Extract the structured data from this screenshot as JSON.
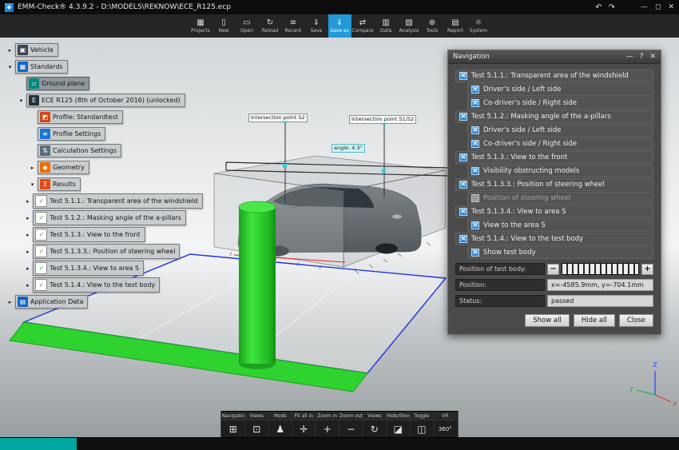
{
  "window": {
    "title": "EMM-Check® 4.3.9.2 - D:\\MODELS\\REKNOW\\ECE_R125.ecp",
    "icons": {
      "app": "◆",
      "undo": "↶",
      "redo": "↷",
      "minimize": "—",
      "maximize": "◻",
      "close": "✕"
    }
  },
  "toolbar": {
    "items": [
      {
        "label": "Projects",
        "icon": "▦"
      },
      {
        "label": "New",
        "icon": "▯"
      },
      {
        "label": "Open",
        "icon": "▭"
      },
      {
        "label": "Reload",
        "icon": "↻"
      },
      {
        "label": "Recent",
        "icon": "≡"
      },
      {
        "label": "Save",
        "icon": "⇓"
      },
      {
        "label": "Save as",
        "icon": "⇓",
        "active": true
      },
      {
        "label": "Compare",
        "icon": "⇄"
      },
      {
        "label": "Data",
        "icon": "▥"
      },
      {
        "label": "Analysis",
        "icon": "▧"
      },
      {
        "label": "Tools",
        "icon": "⊕"
      },
      {
        "label": "Report",
        "icon": "▤"
      },
      {
        "label": "System",
        "icon": "☼"
      }
    ]
  },
  "tree": {
    "items": [
      {
        "label": "Vehicle",
        "level": 0,
        "arrow": "▸",
        "glyph": "▣",
        "color": "#37474f"
      },
      {
        "label": "Standards",
        "level": 0,
        "arrow": "▾",
        "glyph": "▦",
        "color": "#1565c0"
      },
      {
        "label": "Ground plane",
        "level": 1,
        "arrow": "",
        "glyph": "▱",
        "color": "#00897b",
        "selected": true
      },
      {
        "label": "ECE R125 (8th of October 2016) (unlocked)",
        "level": 1,
        "arrow": "▾",
        "glyph": "E",
        "color": "#263238"
      },
      {
        "label": "Profile: Standardtest",
        "level": 2,
        "arrow": "",
        "glyph": "◩",
        "color": "#d84315"
      },
      {
        "label": "Profile Settings",
        "level": 2,
        "arrow": "",
        "glyph": "≡",
        "color": "#1976d2"
      },
      {
        "label": "Calculation Settings",
        "level": 2,
        "arrow": "",
        "glyph": "⇅",
        "color": "#546e7a"
      },
      {
        "label": "Geometry",
        "level": 2,
        "arrow": "▸",
        "glyph": "◆",
        "color": "#ef6c00"
      },
      {
        "label": "Results",
        "level": 2,
        "arrow": "▾",
        "glyph": "Σ",
        "color": "#e64a19"
      },
      {
        "label": "Test 5.1.1.: Transparent area of the windshield",
        "level": 1.6,
        "arrow": "▸",
        "glyph": "✓",
        "color": "#ffffff",
        "fg": "#1db11d"
      },
      {
        "label": "Test 5.1.2.: Masking angle of the a-pillars",
        "level": 1.6,
        "arrow": "▸",
        "glyph": "✓",
        "color": "#ffffff",
        "fg": "#1db11d"
      },
      {
        "label": "Test 5.1.3.: View to the front",
        "level": 1.6,
        "arrow": "▸",
        "glyph": "✓",
        "color": "#ffffff",
        "fg": "#1db11d"
      },
      {
        "label": "Test 5.1.3.3.: Position of steering wheel",
        "level": 1.6,
        "arrow": "▸",
        "glyph": "✓",
        "color": "#ffffff",
        "fg": "#1db11d"
      },
      {
        "label": "Test 5.1.3.4.: View to area S",
        "level": 1.6,
        "arrow": "▸",
        "glyph": "✓",
        "color": "#ffffff",
        "fg": "#1db11d"
      },
      {
        "label": "Test 5.1.4.: View to the test body",
        "level": 1.6,
        "arrow": "▸",
        "glyph": "✓",
        "color": "#ffffff",
        "fg": "#1db11d"
      },
      {
        "label": "Application Data",
        "level": 0,
        "arrow": "▸",
        "glyph": "▤",
        "color": "#1565c0"
      }
    ]
  },
  "navigation": {
    "title": "Navigation",
    "icons": {
      "minimize": "—",
      "help": "?",
      "close": "✕"
    },
    "items": [
      {
        "label": "Test 5.1.1.: Transparent area of the windshield",
        "level": 0,
        "check": "×"
      },
      {
        "label": "Driver's side / Left side",
        "level": 1,
        "check": "×"
      },
      {
        "label": "Co-driver's side / Right side",
        "level": 1,
        "check": "×"
      },
      {
        "label": "Test 5.1.2.: Masking angle of the a-pillars",
        "level": 0,
        "check": "×"
      },
      {
        "label": "Driver's side / Left side",
        "level": 1,
        "check": "×"
      },
      {
        "label": "Co-driver's side / Right side",
        "level": 1,
        "check": "×"
      },
      {
        "label": "Test 5.1.3.: View to the front",
        "level": 0,
        "check": "×"
      },
      {
        "label": "Visibility obstructing models",
        "level": 1,
        "check": "×"
      },
      {
        "label": "Test 5.1.3.3.: Position of steering wheel",
        "level": 0,
        "check": "×"
      },
      {
        "label": "Position of steering wheel",
        "level": 1,
        "check": "",
        "unchecked": true,
        "disabled": true
      },
      {
        "label": "Test 5.1.3.4.: View to area S",
        "level": 0,
        "check": "×"
      },
      {
        "label": "View to the area S",
        "level": 1,
        "check": "×"
      },
      {
        "label": "Test 5.1.4.: View to the test body",
        "level": 0,
        "check": "×"
      },
      {
        "label": "Show test body",
        "level": 1,
        "check": "×"
      }
    ],
    "controls": {
      "position_of_test_body_label": "Position of test body:",
      "minus": "−",
      "plus": "+",
      "position_label": "Position:",
      "position_value": "x=-4585.9mm, y=-704.1mm",
      "status_label": "Status:",
      "status_value": "passed"
    },
    "buttons": [
      {
        "label": "Show all"
      },
      {
        "label": "Hide all"
      },
      {
        "label": "Close"
      }
    ]
  },
  "scene": {
    "annotations": {
      "flag_left": "Intersection point S2",
      "flag_right": "Intersection point S1/S2",
      "angle": "angle: 4.3°"
    },
    "axes": {
      "x": "X",
      "y": "Y",
      "z": "Z"
    },
    "colors": {
      "cylinder_green": "#2fd32f",
      "strip_green": "#2fd32f",
      "plane_outline_blue": "#2233dd",
      "accent_blue": "#2399d6",
      "checkbox_blue": "#2e9ae8",
      "axis_x": "#e53935",
      "axis_y": "#2bb24c",
      "axis_z": "#2244ee",
      "status_teal": "#00a8a0"
    }
  },
  "bottom_toolbar": {
    "items": [
      {
        "label": "Navigation",
        "glyph": "⊞"
      },
      {
        "label": "Views",
        "glyph": "⊡"
      },
      {
        "label": "Mods",
        "glyph": "♟"
      },
      {
        "label": "Fit all in",
        "glyph": "✛"
      },
      {
        "label": "Zoom in",
        "glyph": "+"
      },
      {
        "label": "Zoom out",
        "glyph": "−"
      },
      {
        "label": "Views",
        "glyph": "↻"
      },
      {
        "label": "Hide/Show",
        "glyph": "◪"
      },
      {
        "label": "Toggle",
        "glyph": "◫"
      },
      {
        "label": "VR",
        "glyph": "360°",
        "small": true
      }
    ]
  }
}
